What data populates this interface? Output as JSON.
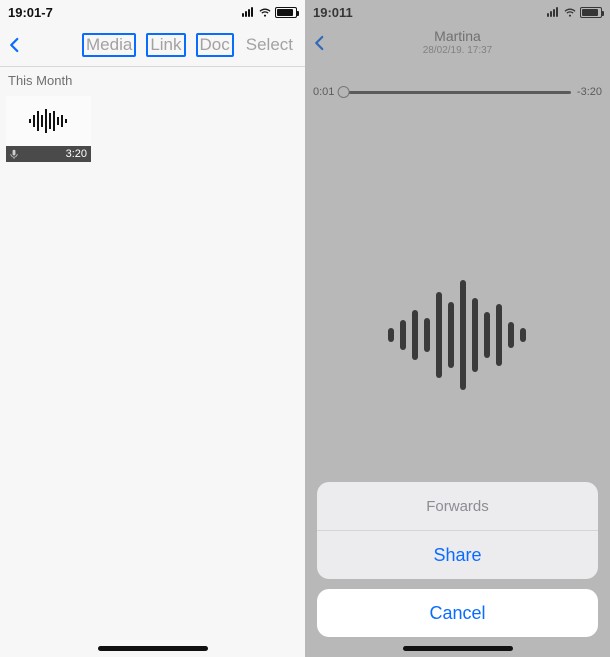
{
  "left": {
    "status_time": "19:01-7",
    "tabs": {
      "media": "Media",
      "link": "Link",
      "doc": "Doc"
    },
    "select_label": "Select",
    "section_label": "This Month",
    "voice_thumb": {
      "duration": "3:20"
    }
  },
  "right": {
    "status_time": "19:011",
    "contact_name": "Martina",
    "timestamp": "28/02/19. 17:37",
    "playback": {
      "elapsed": "0:01",
      "remaining": "-3:20"
    },
    "sheet": {
      "forwards": "Forwards",
      "share": "Share",
      "cancel": "Cancel"
    }
  },
  "colors": {
    "accent": "#0a6cff"
  }
}
